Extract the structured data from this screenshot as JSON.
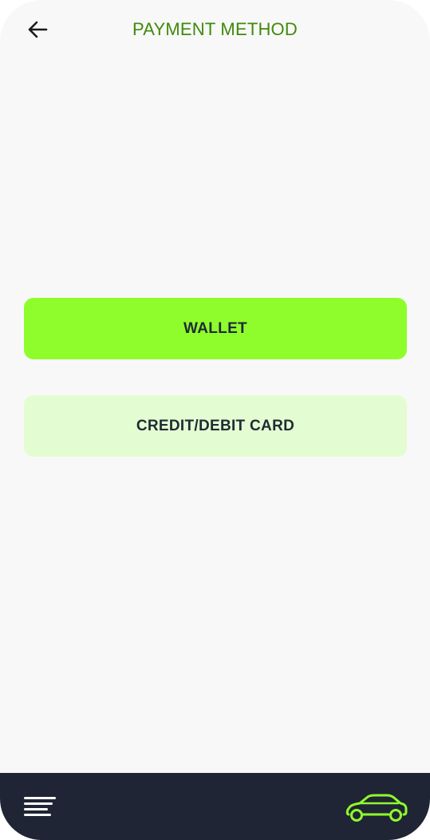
{
  "header": {
    "title": "PAYMENT METHOD",
    "back_icon": "arrow-left-icon"
  },
  "options": [
    {
      "label": "WALLET",
      "color": "#8ffd2b",
      "selected": true
    },
    {
      "label": "CREDIT/DEBIT CARD",
      "color": "#e4fcd1",
      "selected": false
    }
  ],
  "bottom_bar": {
    "background": "#1f2535",
    "menu_icon": "menu-lines-icon",
    "car_icon": "car-icon",
    "car_icon_color": "#8ffd2b"
  },
  "colors": {
    "accent": "#3f8a0c",
    "background": "#f8f8f8",
    "text": "#1f2b36"
  }
}
